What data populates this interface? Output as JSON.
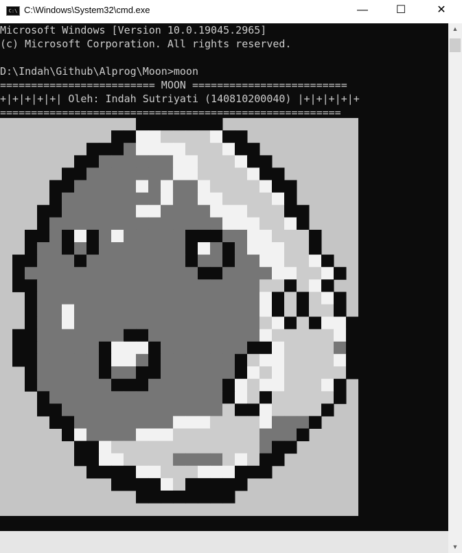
{
  "window": {
    "title": "C:\\Windows\\System32\\cmd.exe",
    "icon_label": "C:\\",
    "icon": "cmd-icon",
    "controls": {
      "minimize": "—",
      "maximize": "☐",
      "close": "✕"
    }
  },
  "console": {
    "lines": [
      "Microsoft Windows [Version 10.0.19045.2965]",
      "(c) Microsoft Corporation. All rights reserved.",
      "",
      "D:\\Indah\\Github\\Alprog\\Moon>moon",
      "========================= MOON =========================",
      "+|+|+|+|+| Oleh: Indah Sutriyati (140810200040) |+|+|+|+|+",
      "======================================================="
    ],
    "colors": {
      "background": "#0c0c0c",
      "text": "#cccccc"
    }
  },
  "moon_art": {
    "palette": {
      "K": "#0c0c0c",
      "G": "#767676",
      "L": "#cccccc",
      "W": "#f2f2f2",
      "B": "#c5c5c5"
    },
    "rows": [
      "BBBBBBBBBBBKKKKKKKBBBBBBBBBBB",
      "BBBBBBBBBKKWWLLLLWKKBBBBBBBBB",
      "BBBBBBBKKKGWWWWLLLWKKBBBBBBBB",
      "BBBBBBKKGGGGGGWWLLLWKKBBBBBBB",
      "BBBBBKKGGGGGGGWWLLLLWKKBBBBBB",
      "BBBBKKGGGGGWGWGGWLLLLWKKBBBBB",
      "BBBBKGGGGGGGGWGGWWLLLLWKBBBBB",
      "BBBKKGGGGGGWWGGGGWWWLLLKKBBBB",
      "BBBKGGGGGGGGGGGGGGWWWLLWKBBBB",
      "BBKKGKWKGWGGGGGKKKGGWWLLLKBBB",
      "BBKGGKGKGGGGGGGKWGKGWWWLLKBBB",
      "BKKGGGKGGGGGGGGKGGKGGWWLLWKBB",
      "BKGGGGGGGGGGGGGGKKGGGGWWLLWKB",
      "BKKGGGGGGGGGGGGGGGGGGLLKLWKBB",
      "BBKGGGGGGGGGGGGGGGGGGWKLKLWKB",
      "BBKGGWGGGGGGGGGGGGGGGWKLKLLKB",
      "BBKGGWGGGGGGGGGGGGGGGLWKLKWWKB",
      "BKKGGGGGGGKKGGGGGGGGGWLLLLLWKB",
      "BKKGGGGGKWWWKGGGGGGGKKWLLLLGKB",
      "BKKGGGGGKWWGKGGGGGGKLWWLLLLWKB",
      "BBKGGGGGKGGKKGGGGGGKWLWLLLLLKB",
      "BBKGGGGGGKKKGGGGGGKWLWWLLLWKBB",
      "BBBKGGGGGGGGGGGGGGKWLKLLLLLKBB",
      "BBBKKGGGGGGGGGGGGGLKKWLLLLKBBB",
      "BBBBKKGGGGGGGGWWWLLLLWGGGKBBBB",
      "BBBBBKWGGGGWWWLLLLLLLGGGKBBBBB",
      "BBBBBBKKWLLLLLLLLLLLLGKKBBBBBB",
      "BBBBBBKKWWLLLLGGGGLWLKKBBBBBBB",
      "BBBBBBBKKKKWWLLLWWWKKKBBBBBBBB",
      "BBBBBBBBBKKKKWLKKKKKBBBBBBBBBB",
      "BBBBBBBBBBBKKKKKKKKBBBBBBBBBBB",
      "BBBBBBBBBBBBBBBBBBBBBBBBBBBBBB"
    ]
  },
  "scrollbar": {
    "up_icon": "▲",
    "down_icon": "▼"
  }
}
